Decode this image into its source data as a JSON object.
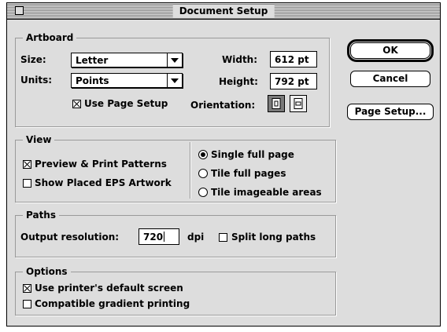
{
  "window": {
    "title": "Document Setup"
  },
  "artboard": {
    "legend": "Artboard",
    "size_label": "Size:",
    "size_value": "Letter",
    "units_label": "Units:",
    "units_value": "Points",
    "width_label": "Width:",
    "width_value": "612 pt",
    "height_label": "Height:",
    "height_value": "792 pt",
    "use_page_setup_label": "Use Page Setup",
    "use_page_setup_checked": true,
    "orientation_label": "Orientation:",
    "orientation_selected": "portrait"
  },
  "view": {
    "legend": "View",
    "preview_print_patterns_label": "Preview & Print Patterns",
    "preview_print_patterns_checked": true,
    "show_placed_eps_label": "Show Placed EPS Artwork",
    "show_placed_eps_checked": false,
    "radio_single": "Single full page",
    "radio_tile_full": "Tile full pages",
    "radio_tile_imageable": "Tile imageable areas",
    "selected_radio": "Single full page"
  },
  "paths": {
    "legend": "Paths",
    "output_resolution_label": "Output resolution:",
    "output_resolution_value": "720",
    "dpi_label": "dpi",
    "split_long_paths_label": "Split long paths",
    "split_long_paths_checked": false
  },
  "options": {
    "legend": "Options",
    "printer_default_screen_label": "Use printer's default screen",
    "printer_default_screen_checked": true,
    "compatible_gradient_label": "Compatible gradient printing",
    "compatible_gradient_checked": false
  },
  "buttons": {
    "ok": "OK",
    "cancel": "Cancel",
    "page_setup": "Page Setup..."
  },
  "icons": {
    "close": "close-box-icon",
    "portrait": "portrait-page-icon",
    "landscape": "landscape-page-icon"
  }
}
